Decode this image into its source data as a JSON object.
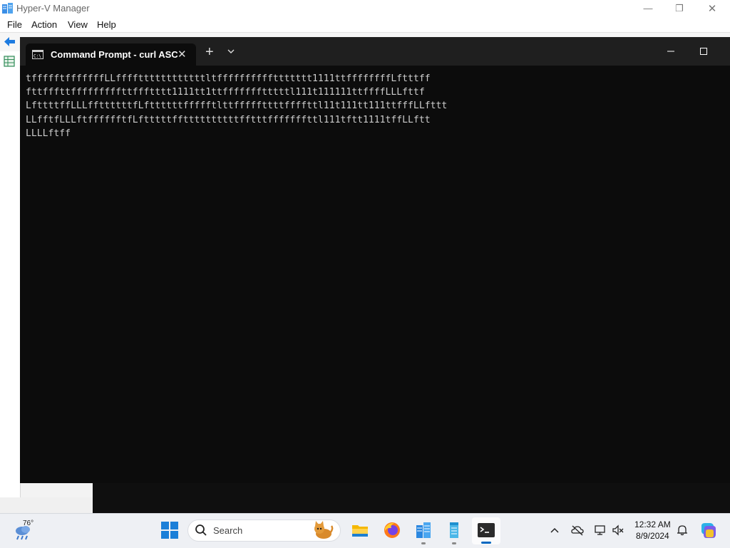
{
  "hyperv": {
    "title": "Hyper-V Manager",
    "menu": [
      "File",
      "Action",
      "View",
      "Help"
    ],
    "controls": {
      "minimize": "—",
      "restore": "❐",
      "close": "✕"
    }
  },
  "terminal": {
    "tab_title": "Command Prompt - curl  ASC",
    "tab_close": "✕",
    "new_tab": "+",
    "lines": [
      "tffffftfffffffLLffffttttttttttttltffffffffffttttttt1111ttffffffffLftttff",
      "fttfffttfffffffffttffftttt1111tt1ttffffffftttttl111t111111ttffffLLLfttf",
      "LfttttffLLLffttttttfLfttttttffffftlttfffffttttffffttl11t111tt111ttfffLLfttt",
      "LLfftfLLLftfffffftfLftttttffttttttttttfftttfffffffttl111tftt1111tffLLftt",
      "LLLLftff"
    ]
  },
  "taskbar": {
    "weather_temp": "76°",
    "search_label": "Search",
    "clock_time": "12:32 AM",
    "clock_date": "8/9/2024"
  },
  "colors": {
    "terminal_bg": "#0c0c0c",
    "terminal_text": "#cccccc",
    "accent": "#0067c0"
  }
}
